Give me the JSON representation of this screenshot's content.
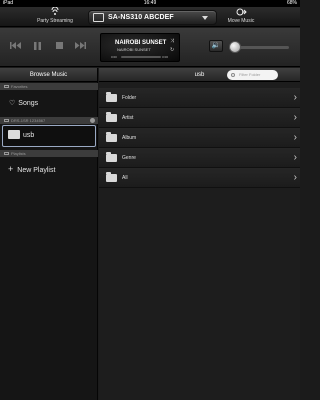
{
  "status_bar": {
    "carrier": "iPad",
    "time": "16:49",
    "battery": "68%"
  },
  "header": {
    "party_streaming_label": "Party Streaming",
    "speaker_name": "SA-NS310 ABCDEF",
    "move_music_label": "Move Music"
  },
  "player": {
    "track_title": "NAIROBI SUNSET",
    "track_subtitle": "NAIROBI SUNSET",
    "elapsed": "0:00",
    "remaining": "0:00",
    "progress_percent": 0,
    "volume_percent": 10
  },
  "sidebar": {
    "title": "Browse Music",
    "favorites_header": "Favorites",
    "songs_label": "Songs",
    "server_header": "DRS-1SR 1234567",
    "usb_label": "usb",
    "playlists_header": "Playlists",
    "new_playlist_label": "New Playlist"
  },
  "main": {
    "title": "usb",
    "filter_placeholder": "Filter Folder",
    "items": [
      {
        "label": "Folder"
      },
      {
        "label": "Artist"
      },
      {
        "label": "Album"
      },
      {
        "label": "Genre"
      },
      {
        "label": "All"
      }
    ]
  }
}
